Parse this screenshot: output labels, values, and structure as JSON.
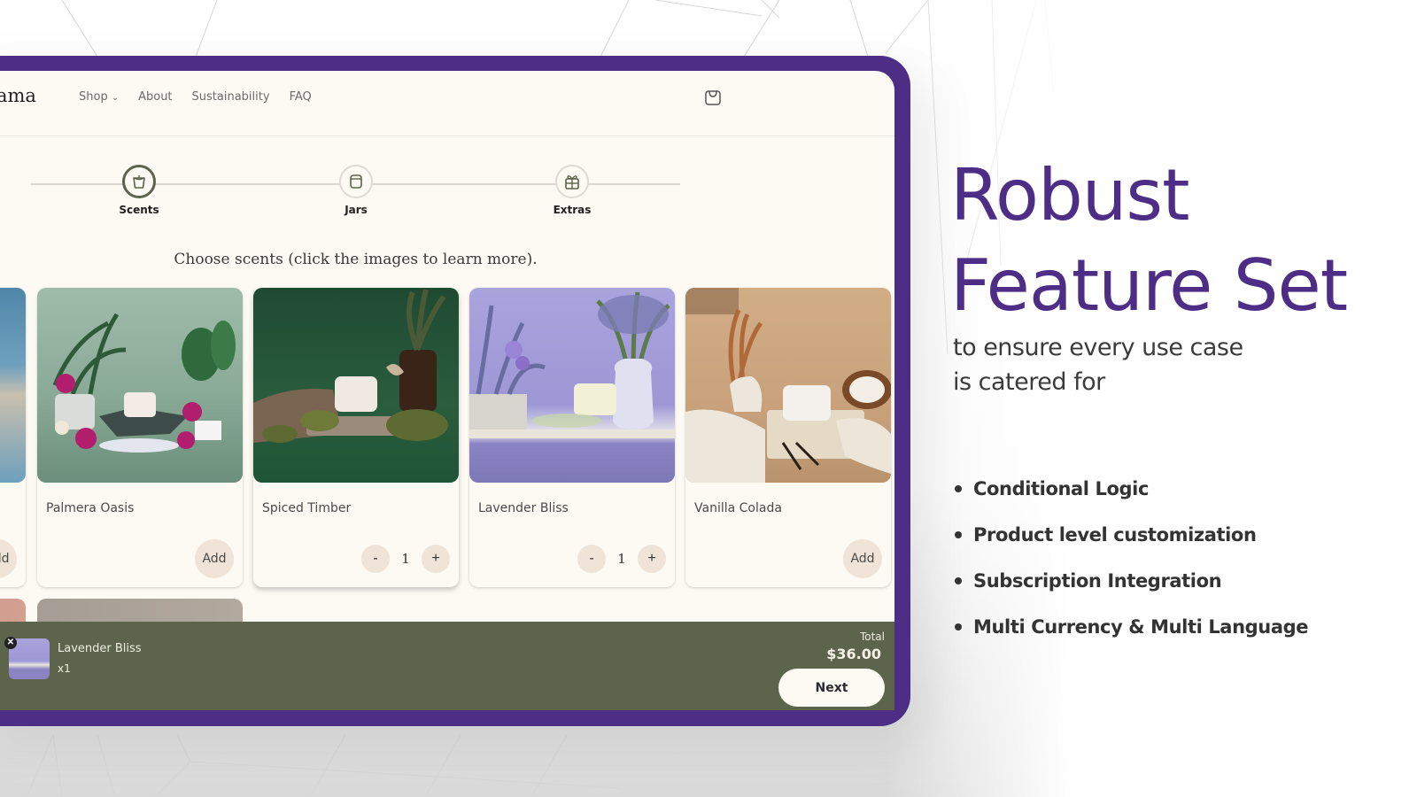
{
  "colors": {
    "frame": "#4e2d87",
    "screen_bg": "#fdf9f3",
    "accent_green": "#5c654c",
    "button_beige": "#efe4d7",
    "headline": "#4e2d87"
  },
  "store": {
    "logo_text": "ama",
    "nav": [
      {
        "label": "Shop",
        "has_dropdown": true
      },
      {
        "label": "About"
      },
      {
        "label": "Sustainability"
      },
      {
        "label": "FAQ"
      }
    ],
    "cart_icon": "shopping-bag-icon"
  },
  "stepper": {
    "steps": [
      {
        "label": "Scents",
        "icon": "candle-icon",
        "active": true
      },
      {
        "label": "Jars",
        "icon": "jar-icon",
        "active": false
      },
      {
        "label": "Extras",
        "icon": "gift-icon",
        "active": false
      }
    ]
  },
  "prompt": "Choose scents (click the images to learn more).",
  "products": [
    {
      "name": "",
      "action": "Add",
      "partial": true
    },
    {
      "name": "Palmera Oasis",
      "action": "Add",
      "qty": null
    },
    {
      "name": "Spiced Timber",
      "action": "qty",
      "qty": "1"
    },
    {
      "name": "Lavender Bliss",
      "action": "qty",
      "qty": "1"
    },
    {
      "name": "Vanilla Colada",
      "action": "Add",
      "qty": null
    }
  ],
  "qty_controls": {
    "minus": "-",
    "plus": "+"
  },
  "footer": {
    "selected_item": {
      "name": "Lavender Bliss",
      "qty": "x1",
      "remove_icon": "close-icon"
    },
    "total_label": "Total",
    "total_value": "$36.00",
    "next_label": "Next"
  },
  "hero": {
    "title_line1": "Robust",
    "title_line2": "Feature Set",
    "subtitle_line1": "to ensure every use case",
    "subtitle_line2": "is catered for",
    "features": [
      "Conditional Logic",
      "Product level customization",
      "Subscription Integration",
      "Multi Currency & Multi Language"
    ]
  }
}
